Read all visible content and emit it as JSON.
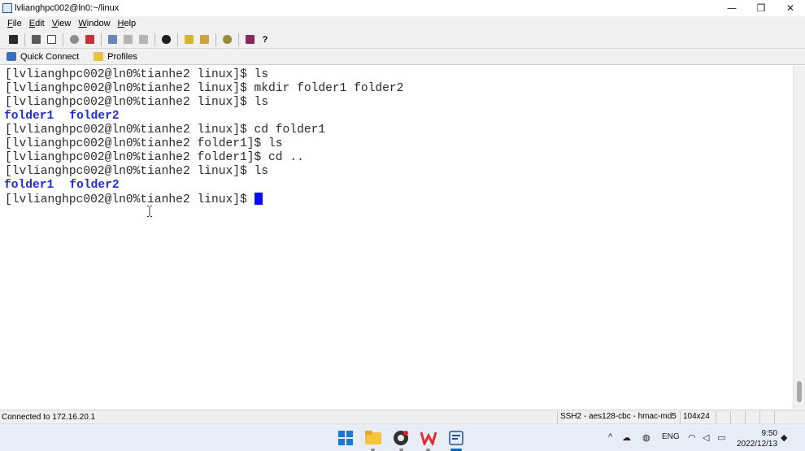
{
  "window": {
    "title": "lvlianghpc002@ln0:~/linux",
    "controls": {
      "minimize": "—",
      "maximize": "❐",
      "close": "✕"
    }
  },
  "menu": [
    {
      "label": "File",
      "accel": "F",
      "rest": "ile"
    },
    {
      "label": "Edit",
      "accel": "E",
      "rest": "dit"
    },
    {
      "label": "View",
      "accel": "V",
      "rest": "iew"
    },
    {
      "label": "Window",
      "accel": "W",
      "rest": "indow"
    },
    {
      "label": "Help",
      "accel": "H",
      "rest": "elp"
    }
  ],
  "toolbar_icons": [
    "save-icon",
    "print-icon",
    "print-preview-icon",
    "cut-icon",
    "cancel-icon",
    "copy-icon",
    "paste-icon",
    "clear-icon",
    "find-icon",
    "transfer-icon",
    "session-options-icon",
    "key-icon",
    "scripts-icon",
    "help-cursor-icon"
  ],
  "connectbar": {
    "quick_connect": "Quick Connect",
    "profiles": "Profiles"
  },
  "terminal": {
    "lines": [
      "[lvlianghpc002@ln0%tianhe2 linux]$ ls",
      "[lvlianghpc002@ln0%tianhe2 linux]$ mkdir folder1 folder2",
      "[lvlianghpc002@ln0%tianhe2 linux]$ ls",
      "",
      "[lvlianghpc002@ln0%tianhe2 linux]$ cd folder1",
      "[lvlianghpc002@ln0%tianhe2 folder1]$ ls",
      "[lvlianghpc002@ln0%tianhe2 folder1]$ cd ..",
      "[lvlianghpc002@ln0%tianhe2 linux]$ ls",
      "",
      "[lvlianghpc002@ln0%tianhe2 linux]$ "
    ],
    "dir_listing": [
      "folder1",
      "folder2"
    ]
  },
  "status": {
    "connection": "Connected to 172.16.20.1",
    "encryption": "SSH2 - aes128-cbc - hmac-md5",
    "size": "104x24"
  },
  "taskbar": {
    "apps": [
      "windows-start-icon",
      "file-explorer-icon",
      "browser-icon",
      "wps-office-icon",
      "securecrt-icon"
    ],
    "tray_lang": "ENG",
    "clock_time": "9:50",
    "clock_date": "2022/12/13"
  },
  "colors": {
    "directory": "#1f2fcf",
    "cursor": "#0a0aff",
    "accent": "#0067c0"
  }
}
